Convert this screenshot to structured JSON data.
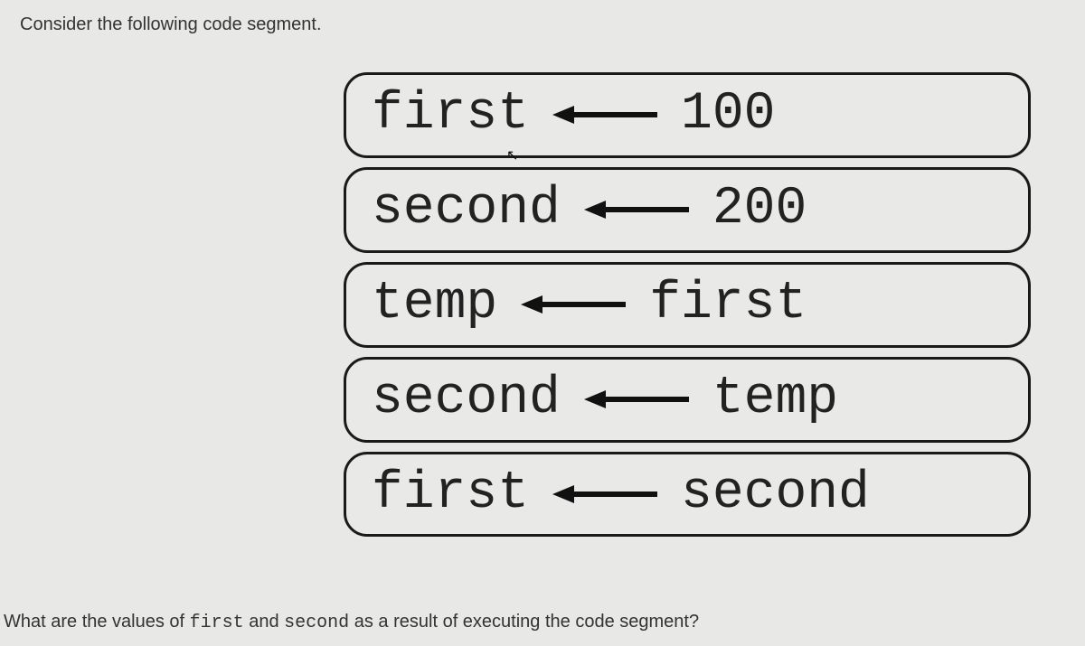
{
  "intro": "Consider the following code segment.",
  "lines": [
    {
      "lhs": "first",
      "rhs": "100"
    },
    {
      "lhs": "second",
      "rhs": "200"
    },
    {
      "lhs": "temp",
      "rhs": "first"
    },
    {
      "lhs": "second",
      "rhs": "temp"
    },
    {
      "lhs": "first",
      "rhs": "second"
    }
  ],
  "question": {
    "pre": "What are the values of ",
    "var1": "first",
    "mid": " and ",
    "var2": "second",
    "post": " as a result of executing the code segment?"
  }
}
